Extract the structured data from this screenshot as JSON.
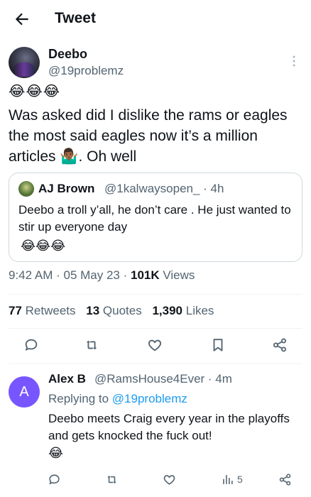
{
  "header": {
    "title": "Tweet"
  },
  "tweet": {
    "author_name": "Deebo",
    "author_handle": "@19problemz",
    "emoji_line": "😂😂😂",
    "text": "Was asked did I dislike the rams or eagles the most said eagles now it’s a million articles 🤷🏾‍♂️. Oh well",
    "quote": {
      "name": "AJ Brown",
      "handle_time": "@1kalwaysopen_ · 4h",
      "text": "Deebo a troll y’all, he don’t care . He just wanted to stir up everyone day",
      "emoji": "😂😂😂"
    },
    "time": "9:42 AM",
    "date": "05 May 23",
    "views_count": "101K",
    "views_label": "Views",
    "retweets_count": "77",
    "retweets_label": "Retweets",
    "quotes_count": "13",
    "quotes_label": "Quotes",
    "likes_count": "1,390",
    "likes_label": "Likes"
  },
  "reply": {
    "avatar_letter": "A",
    "avatar_color": "#7856ff",
    "name": "Alex B",
    "handle_time": "@RamsHouse4Ever · 4m",
    "replying_prefix": "Replying to",
    "replying_handle": "@19problemz",
    "text": "Deebo meets Craig every year in the playoffs and gets knocked the fuck out!",
    "emoji": "😂",
    "views": "5"
  },
  "icons": [
    "back-arrow-icon",
    "more-vertical-icon",
    "reply-icon",
    "retweet-icon",
    "like-icon",
    "bookmark-icon",
    "share-icon",
    "views-icon"
  ],
  "colors": {
    "accent": "#1d9bf0",
    "secondary_text": "#536471",
    "divider": "#eff3f4"
  }
}
